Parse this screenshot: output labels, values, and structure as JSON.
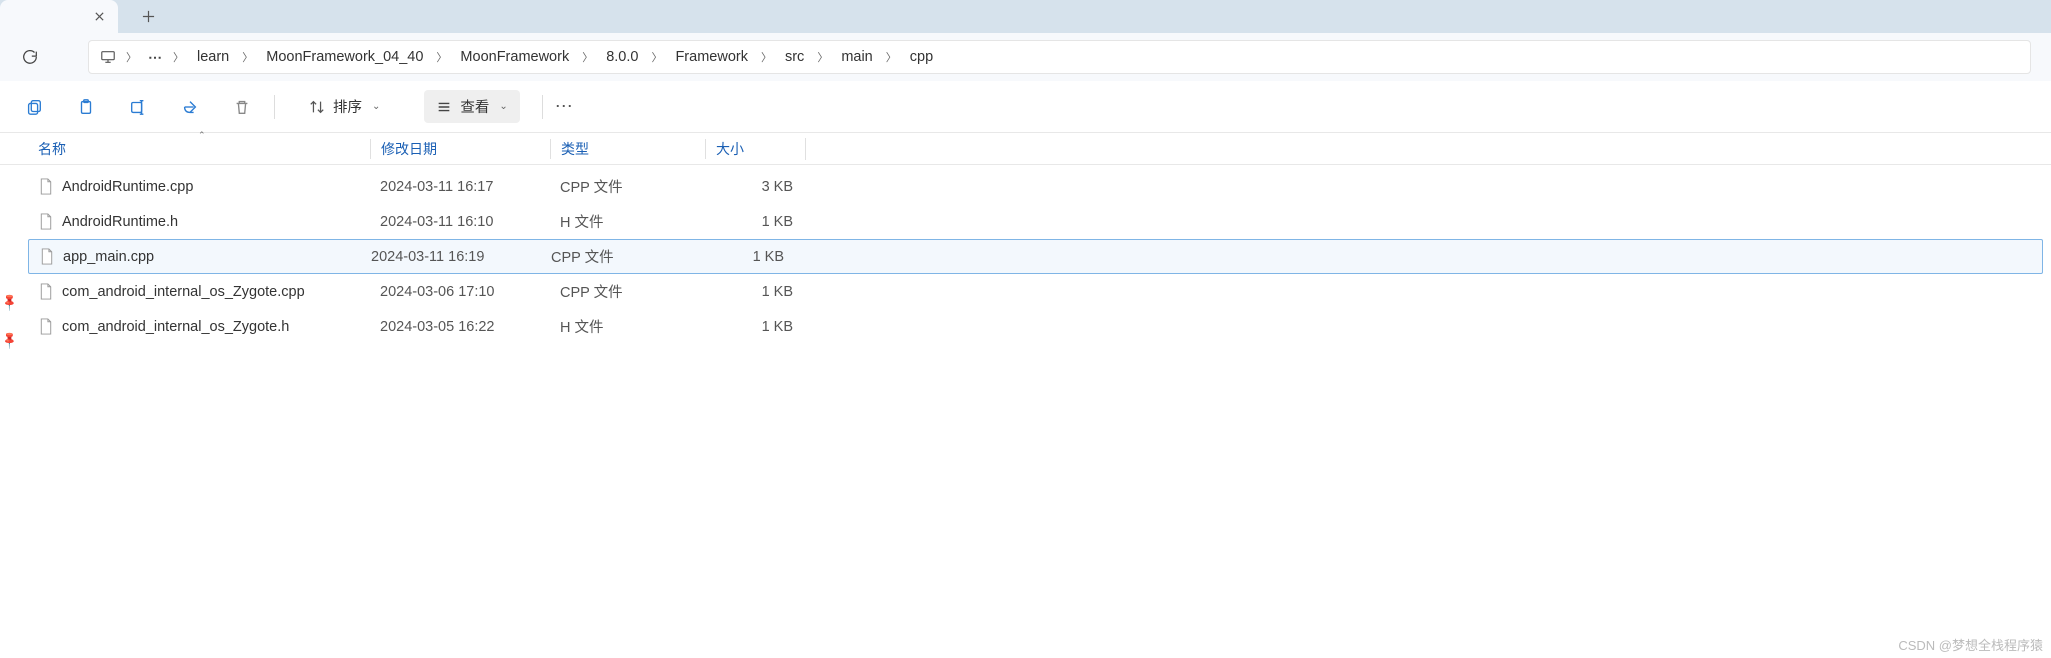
{
  "breadcrumb": {
    "items": [
      "learn",
      "MoonFramework_04_40",
      "MoonFramework",
      "8.0.0",
      "Framework",
      "src",
      "main",
      "cpp"
    ]
  },
  "toolbar": {
    "sort_label": "排序",
    "view_label": "查看"
  },
  "headers": {
    "name": "名称",
    "modified": "修改日期",
    "type": "类型",
    "size": "大小"
  },
  "files": [
    {
      "name": "AndroidRuntime.cpp",
      "modified": "2024-03-11 16:17",
      "type": "CPP 文件",
      "size": "3 KB",
      "selected": false
    },
    {
      "name": "AndroidRuntime.h",
      "modified": "2024-03-11 16:10",
      "type": "H 文件",
      "size": "1 KB",
      "selected": false
    },
    {
      "name": "app_main.cpp",
      "modified": "2024-03-11 16:19",
      "type": "CPP 文件",
      "size": "1 KB",
      "selected": true
    },
    {
      "name": "com_android_internal_os_Zygote.cpp",
      "modified": "2024-03-06 17:10",
      "type": "CPP 文件",
      "size": "1 KB",
      "selected": false
    },
    {
      "name": "com_android_internal_os_Zygote.h",
      "modified": "2024-03-05 16:22",
      "type": "H 文件",
      "size": "1 KB",
      "selected": false
    }
  ],
  "watermark": "CSDN @梦想全栈程序猿"
}
